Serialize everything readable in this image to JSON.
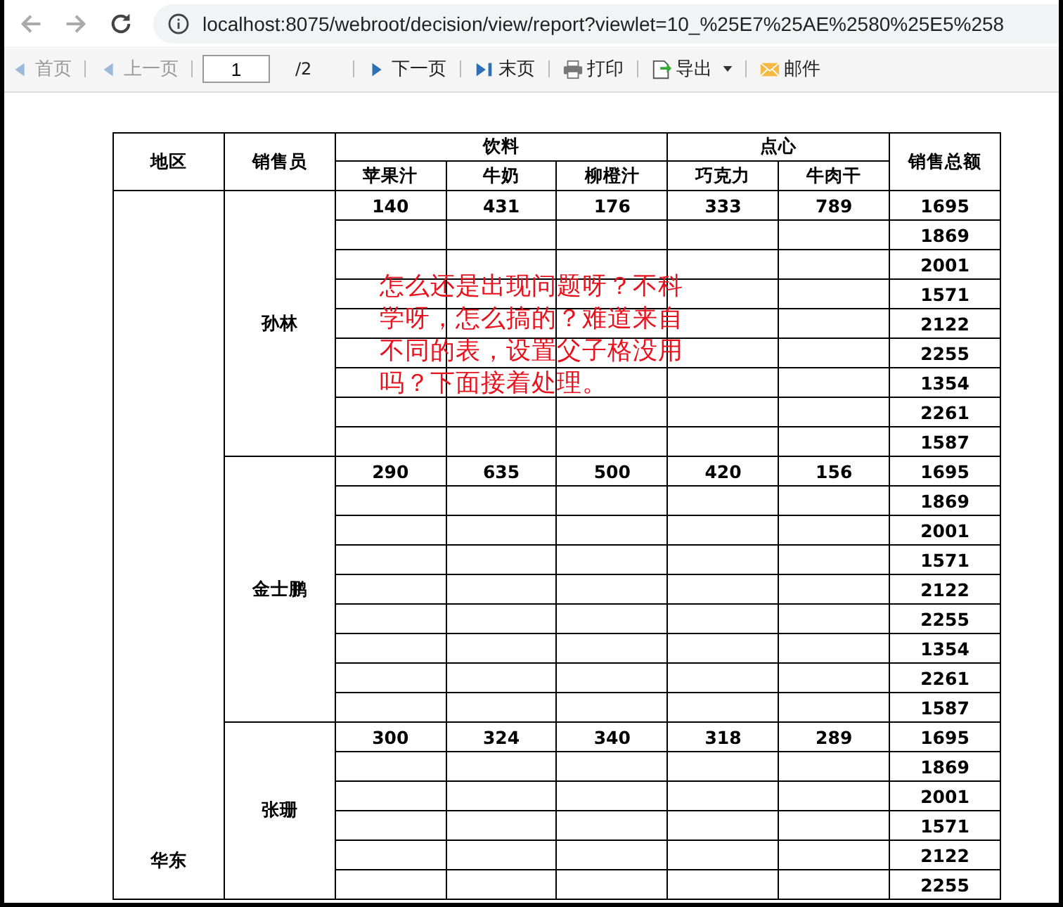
{
  "browser": {
    "url": "localhost:8075/webroot/decision/view/report?viewlet=10_%25E7%25AE%2580%25E5%258"
  },
  "toolbar": [
    {
      "kind": "first",
      "label": "首页",
      "disabled": true
    },
    {
      "kind": "prev",
      "label": "上一页",
      "disabled": true
    },
    {
      "kind": "page",
      "value": "1",
      "total": "/2"
    },
    {
      "kind": "next",
      "label": "下一页",
      "disabled": false
    },
    {
      "kind": "last",
      "label": "末页",
      "disabled": false
    },
    {
      "kind": "print",
      "label": "打印",
      "disabled": false
    },
    {
      "kind": "export",
      "label": "导出",
      "disabled": false
    },
    {
      "kind": "mail",
      "label": "邮件",
      "disabled": false
    }
  ],
  "table": {
    "region_header": "地区",
    "seller_header": "销售员",
    "total_header": "销售总额",
    "groups": [
      {
        "label": "饮料",
        "columns": [
          "苹果汁",
          "牛奶",
          "柳橙汁"
        ]
      },
      {
        "label": "点心",
        "columns": [
          "巧克力",
          "牛肉干"
        ]
      }
    ],
    "region": "华东",
    "sellers": [
      {
        "name": "孙林",
        "rows": [
          {
            "cells": [
              "140",
              "431",
              "176",
              "333",
              "789"
            ],
            "total": "1695"
          },
          {
            "total": "1869"
          },
          {
            "total": "2001"
          },
          {
            "total": "1571"
          },
          {
            "total": "2122"
          },
          {
            "total": "2255"
          },
          {
            "total": "1354"
          },
          {
            "total": "2261"
          },
          {
            "total": "1587"
          }
        ]
      },
      {
        "name": "金士鹏",
        "rows": [
          {
            "cells": [
              "290",
              "635",
              "500",
              "420",
              "156"
            ],
            "total": "1695"
          },
          {
            "total": "1869"
          },
          {
            "total": "2001"
          },
          {
            "total": "1571"
          },
          {
            "total": "2122"
          },
          {
            "total": "2255"
          },
          {
            "total": "1354"
          },
          {
            "total": "2261"
          },
          {
            "total": "1587"
          }
        ]
      },
      {
        "name": "张珊",
        "rows": [
          {
            "cells": [
              "300",
              "324",
              "340",
              "318",
              "289"
            ],
            "total": "1695"
          },
          {
            "total": "1869"
          },
          {
            "total": "2001"
          },
          {
            "total": "1571"
          },
          {
            "total": "2122"
          },
          {
            "total": "2255"
          }
        ]
      }
    ]
  },
  "annotation": "怎么还是出现问题呀？不科学呀，怎么搞的？难道来自不同的表，设置父子格没用吗？下面接着处理。"
}
